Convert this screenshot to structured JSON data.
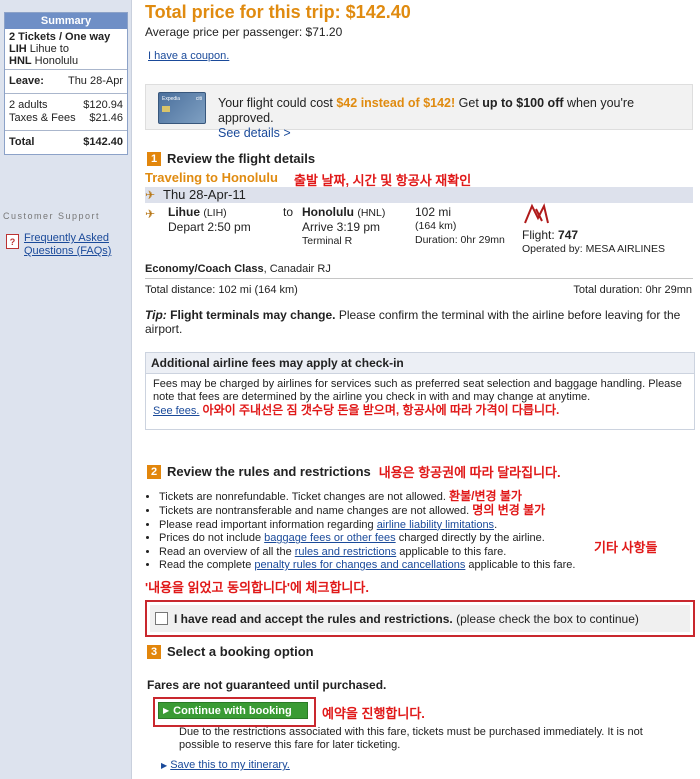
{
  "sidebar": {
    "summary_title": "Summary",
    "trip_line1": "2 Tickets / One way",
    "from_code": "LIH",
    "from_city": "Lihue to",
    "to_code": "HNL",
    "to_city": "Honolulu",
    "leave_label": "Leave:",
    "leave_value": "Thu 28-Apr",
    "adults_label": "2 adults",
    "adults_value": "$120.94",
    "taxes_label": "Taxes & Fees",
    "taxes_value": "$21.46",
    "total_label": "Total",
    "total_value": "$142.40",
    "support_title": "Customer Support",
    "faq_link": "Frequently Asked Questions (FAQs)"
  },
  "header": {
    "total_title": "Total price for this trip: $142.40",
    "avg_price": "Average price per passenger: $71.20",
    "coupon_link": "I have a coupon."
  },
  "promo": {
    "card_brand_left": "Expedia",
    "card_brand_right": "citi",
    "text_before": "Your flight could cost ",
    "highlight": "$42 instead of $142!",
    "text_middle": " Get ",
    "bold_text": "up to $100 off",
    "text_after": " when you're approved.",
    "details_link": "See details >"
  },
  "step1": {
    "num": "1",
    "title": "Review the flight details",
    "destination": "Traveling to Honolulu",
    "annotation": "출발 날짜, 시간 및 항공사 재확인",
    "date": "Thu 28-Apr-11",
    "depart_city": "Lihue",
    "depart_code": "(LIH)",
    "depart_time": "Depart 2:50 pm",
    "to_word": "to",
    "arrive_city": "Honolulu",
    "arrive_code": "(HNL)",
    "arrive_time": "Arrive 3:19 pm",
    "terminal": "Terminal R",
    "distance_mi": "102 mi",
    "distance_km": "(164 km)",
    "duration": "Duration: 0hr 29mn",
    "flight_label": "Flight:",
    "flight_num": "747",
    "operated": "Operated by: MESA AIRLINES",
    "cabin": "Economy/Coach Class",
    "cabin_airline": ", Canadair RJ",
    "total_distance": "Total distance: 102 mi (164 km)",
    "total_duration": "Total duration: 0hr 29mn",
    "tip_label": "Tip:",
    "tip_bold": " Flight terminals may change.",
    "tip_rest": " Please confirm the terminal with the airline before leaving for the airport."
  },
  "fees": {
    "title": "Additional airline fees may apply at check-in",
    "body": "Fees may be charged by airlines for services such as preferred seat selection and baggage handling. Please note that fees are determined by the airline you check in with and may change at anytime.",
    "link": "See fees.",
    "annotation": "아와이 주내선은 짐 갯수당 돈을 받으며, 항공사에 따라 가격이 다릅니다."
  },
  "step2": {
    "num": "2",
    "title": "Review the rules and restrictions",
    "annotation": "내용은 항공권에 따라 달라집니다.",
    "rule1": "Tickets are nonrefundable. Ticket changes are not allowed.",
    "rule1_ann": "환불/변경 불가",
    "rule2": "Tickets are nontransferable and name changes are not allowed.",
    "rule2_ann": "명의 변경 불가",
    "rule3_pre": "Please read important information regarding ",
    "rule3_link": "airline liability limitations",
    "rule3_post": ".",
    "rule4_pre": "Prices do not include ",
    "rule4_link": "baggage fees or other fees",
    "rule4_post": " charged directly by the airline.",
    "rule_ann_other": "기타 사항들",
    "rule5_pre": "Read an overview of all the ",
    "rule5_link": "rules and restrictions",
    "rule5_post": " applicable to this fare.",
    "rule6_pre": "Read the complete ",
    "rule6_link": "penalty rules for changes and cancellations",
    "rule6_post": " applicable to this fare.",
    "check_annotation": "'내용을 읽었고 동의합니다'에 체크합니다.",
    "accept_bold": "I have read and accept the rules and restrictions.",
    "accept_rest": " (please check the box to continue)"
  },
  "step3": {
    "num": "3",
    "title": "Select a booking option",
    "fares_note": "Fares are not guaranteed until purchased.",
    "continue_btn": "Continue with booking",
    "btn_annotation": "예약을 진행합니다.",
    "restriction_note": "Due to the restrictions associated with this fare, tickets must be purchased immediately. It is not possible to reserve this fare for later ticketing.",
    "save_link": "Save this to my itinerary."
  }
}
